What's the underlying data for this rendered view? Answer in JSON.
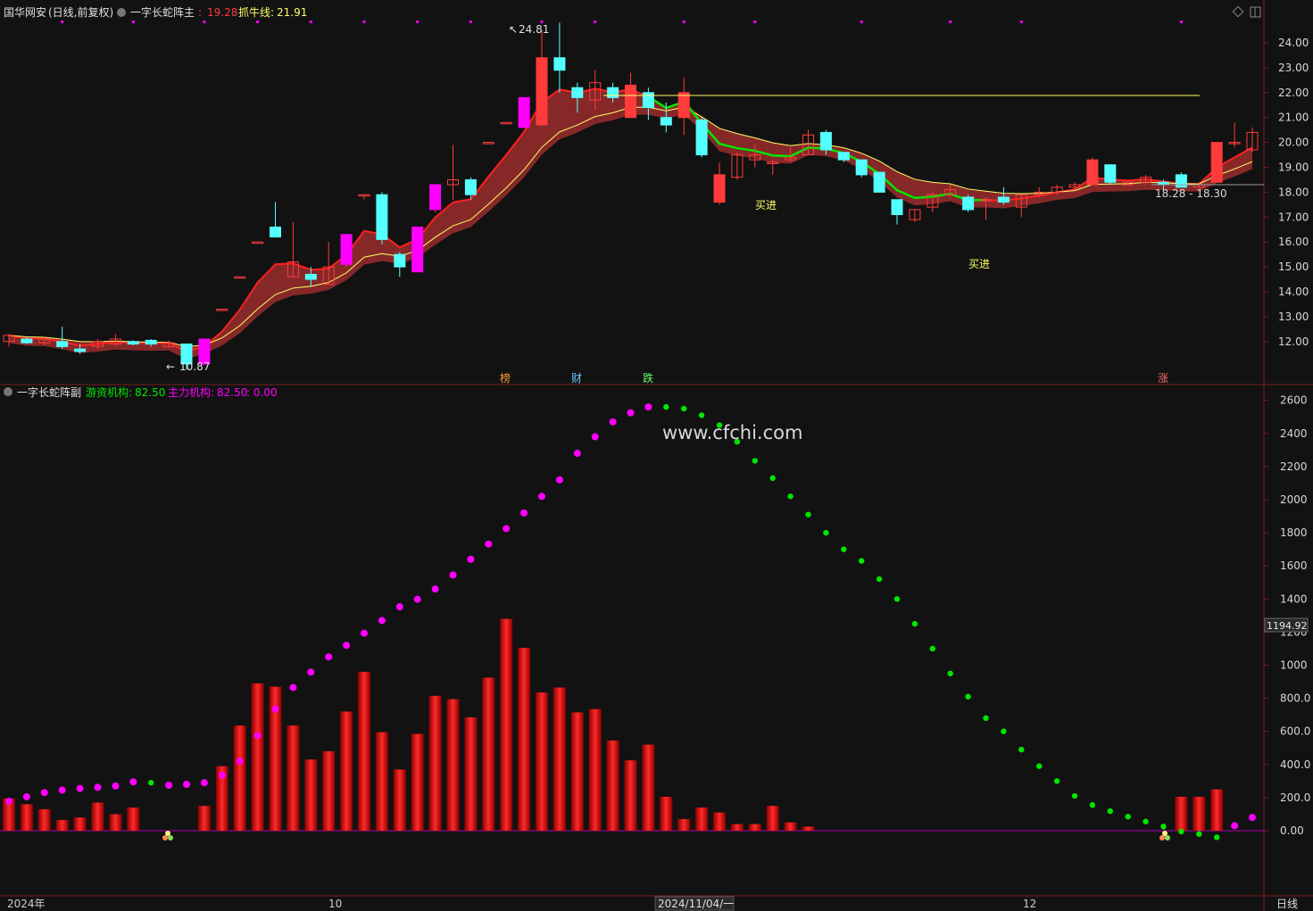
{
  "header_main": {
    "stock": "国华网安",
    "period": "(日线,前复权)",
    "indicator": "一字长蛇阵主",
    "sep": ":",
    "value1": "19.28",
    "label2": "抓牛线:",
    "value2": "21.91"
  },
  "header_sub": {
    "indicator": "一字长蛇阵副",
    "label1": "游资机构:",
    "value1": "82.50",
    "label2": "主力机构:",
    "value2": "82.50",
    "value3": ": 0.00"
  },
  "watermark": "www.cfchi.com",
  "annotations": {
    "high": "24.81",
    "low": "10.87",
    "range": "18.28 - 18.30",
    "buy1": "买进",
    "buy2": "买进",
    "mark_bang": "榜",
    "mark_cai": "财",
    "mark_die": "跌",
    "mark_zhang": "涨"
  },
  "price_axis": [
    "24.00",
    "23.00",
    "22.00",
    "21.00",
    "20.00",
    "19.00",
    "18.00",
    "17.00",
    "16.00",
    "15.00",
    "14.00",
    "13.00",
    "12.00"
  ],
  "sub_axis": [
    "2600",
    "2400",
    "2200",
    "2000",
    "1800",
    "1600",
    "1400",
    "1200",
    "1000",
    "800.0",
    "600.0",
    "400.0",
    "200.0",
    "0.00"
  ],
  "sub_current": "1194.92",
  "date_axis": {
    "start": "2024年",
    "oct": "10",
    "cursor_date": "2024/11/04/一",
    "dec": "12",
    "period_button": "日线"
  },
  "colors": {
    "up": "#ff3b3b",
    "down": "#54ffff",
    "magenta": "#ff00ff",
    "green": "#00e600",
    "yellow": "#ffff66",
    "band": "#9b2d2d"
  },
  "candles": [
    [
      12.0,
      12.25,
      11.8,
      12.3
    ],
    [
      12.1,
      11.95,
      11.9,
      12.2
    ],
    [
      11.95,
      12.1,
      11.85,
      12.2
    ],
    [
      12.0,
      11.8,
      11.7,
      12.6
    ],
    [
      11.7,
      11.6,
      11.5,
      11.9
    ],
    [
      11.8,
      12.0,
      11.7,
      12.1
    ],
    [
      11.9,
      12.1,
      11.8,
      12.3
    ],
    [
      12.0,
      11.9,
      11.85,
      12.05
    ],
    [
      12.05,
      11.9,
      11.8,
      12.1
    ],
    [
      11.8,
      11.95,
      11.75,
      12.05
    ],
    [
      11.9,
      11.1,
      10.87,
      11.9
    ],
    [
      11.1,
      12.1,
      11.05,
      12.1
    ],
    [
      13.3,
      13.3,
      13.3,
      13.3
    ],
    [
      14.6,
      14.6,
      14.6,
      14.6
    ],
    [
      16.0,
      16.0,
      16.0,
      16.0
    ],
    [
      16.6,
      16.2,
      16.2,
      17.6
    ],
    [
      14.6,
      15.2,
      14.6,
      16.8
    ],
    [
      14.7,
      14.5,
      14.2,
      15.0
    ],
    [
      14.3,
      15.0,
      14.3,
      16.0
    ],
    [
      15.1,
      16.3,
      15.0,
      16.3
    ],
    [
      17.9,
      17.9,
      17.7,
      17.9
    ],
    [
      17.9,
      16.1,
      15.9,
      18.0
    ],
    [
      15.5,
      15.0,
      14.6,
      15.6
    ],
    [
      14.8,
      16.6,
      14.8,
      16.6
    ],
    [
      17.3,
      18.3,
      17.2,
      18.3
    ],
    [
      18.3,
      18.5,
      17.7,
      19.9
    ],
    [
      18.5,
      17.9,
      17.7,
      18.6
    ],
    [
      20.0,
      20.0,
      20.0,
      20.0
    ],
    [
      20.8,
      20.8,
      20.8,
      20.8
    ],
    [
      20.6,
      21.8,
      20.6,
      21.8
    ],
    [
      20.7,
      23.4,
      20.7,
      24.5
    ],
    [
      23.4,
      22.9,
      22.0,
      24.81
    ],
    [
      22.2,
      21.8,
      21.2,
      22.4
    ],
    [
      21.7,
      22.4,
      21.3,
      22.9
    ],
    [
      22.2,
      21.8,
      21.6,
      22.4
    ],
    [
      21.0,
      22.3,
      21.0,
      22.8
    ],
    [
      22.0,
      21.4,
      20.9,
      22.2
    ],
    [
      21.0,
      20.7,
      20.4,
      21.6
    ],
    [
      21.0,
      22.0,
      20.3,
      22.6
    ],
    [
      20.9,
      19.5,
      19.4,
      21.0
    ],
    [
      17.6,
      18.7,
      17.5,
      19.2
    ],
    [
      18.6,
      19.5,
      18.5,
      19.6
    ],
    [
      19.3,
      19.5,
      19.0,
      19.9
    ],
    [
      19.2,
      19.2,
      18.7,
      19.3
    ],
    [
      19.3,
      19.4,
      19.2,
      19.8
    ],
    [
      19.5,
      20.3,
      19.5,
      20.5
    ],
    [
      20.4,
      19.7,
      19.5,
      20.5
    ],
    [
      19.6,
      19.3,
      19.2,
      19.6
    ],
    [
      19.3,
      18.7,
      18.6,
      19.3
    ],
    [
      18.8,
      18.0,
      18.0,
      18.8
    ],
    [
      17.7,
      17.1,
      16.7,
      17.7
    ],
    [
      16.9,
      17.3,
      16.8,
      17.3
    ],
    [
      17.4,
      17.9,
      17.2,
      18.0
    ],
    [
      17.9,
      18.1,
      17.8,
      18.3
    ],
    [
      17.8,
      17.3,
      17.2,
      17.9
    ],
    [
      17.7,
      17.7,
      16.9,
      17.8
    ],
    [
      17.8,
      17.6,
      17.5,
      18.2
    ],
    [
      17.4,
      17.9,
      17.0,
      17.9
    ],
    [
      17.9,
      18.0,
      17.8,
      18.2
    ],
    [
      18.0,
      18.2,
      17.9,
      18.3
    ],
    [
      18.2,
      18.3,
      18.1,
      18.4
    ],
    [
      18.3,
      19.3,
      18.3,
      19.4
    ],
    [
      19.1,
      18.4,
      18.3,
      19.1
    ],
    [
      18.3,
      18.4,
      18.3,
      18.5
    ],
    [
      18.4,
      18.6,
      18.3,
      18.7
    ],
    [
      18.4,
      18.3,
      18.1,
      18.5
    ],
    [
      18.7,
      18.2,
      18.2,
      18.8
    ],
    [
      18.2,
      18.3,
      18.2,
      18.4
    ],
    [
      18.4,
      20.0,
      18.4,
      20.0
    ],
    [
      20.0,
      20.0,
      19.8,
      20.8
    ],
    [
      19.7,
      20.4,
      19.6,
      20.6
    ]
  ],
  "volumes": [
    195,
    160,
    130,
    65,
    80,
    170,
    100,
    140,
    0,
    0,
    0,
    150,
    390,
    635,
    890,
    870,
    635,
    430,
    480,
    720,
    960,
    595,
    370,
    585,
    815,
    795,
    685,
    925,
    1280,
    1105,
    835,
    865,
    715,
    735,
    545,
    425,
    520,
    205,
    70,
    140,
    110,
    40,
    40,
    150,
    50,
    25,
    0,
    0,
    0,
    0,
    0,
    0,
    0,
    0,
    0,
    0,
    0,
    0,
    0,
    0,
    0,
    0,
    0,
    0,
    0,
    0,
    205,
    205,
    250
  ],
  "dots": [
    178,
    205,
    230,
    245,
    255,
    262,
    270,
    295,
    290,
    275,
    280,
    290,
    335,
    420,
    575,
    735,
    865,
    958,
    1050,
    1120,
    1193,
    1270,
    1353,
    1398,
    1460,
    1545,
    1640,
    1732,
    1825,
    1920,
    2020,
    2120,
    2280,
    2380,
    2470,
    2525,
    2560,
    2560,
    2550,
    2510,
    2450,
    2350,
    2235,
    2130,
    2020,
    1910,
    1800,
    1700,
    1630,
    1520,
    1400,
    1250,
    1100,
    950,
    810,
    680,
    600,
    490,
    390,
    300,
    210,
    155,
    118,
    85,
    55,
    25,
    -5,
    -20,
    -40,
    30,
    80
  ],
  "dot_switch_index": 8
}
